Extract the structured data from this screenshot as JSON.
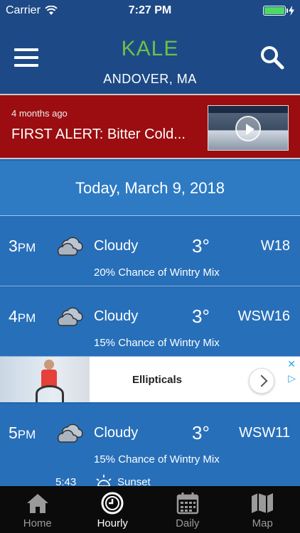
{
  "status_bar": {
    "carrier": "Carrier",
    "time": "7:27 PM",
    "battery_level": 1.0
  },
  "header": {
    "logo": "KALE",
    "location": "ANDOVER, MA"
  },
  "alert": {
    "age": "4 months ago",
    "headline": "FIRST ALERT: Bitter Cold..."
  },
  "forecast": {
    "date": "Today, March 9, 2018",
    "hours": [
      {
        "hour": "3",
        "period": "PM",
        "condition": "Cloudy",
        "temp": "3°",
        "wind": "W18",
        "precip": "20% Chance of Wintry Mix"
      },
      {
        "hour": "4",
        "period": "PM",
        "condition": "Cloudy",
        "temp": "3°",
        "wind": "WSW16",
        "precip": "15% Chance of Wintry Mix"
      },
      {
        "hour": "5",
        "period": "PM",
        "condition": "Cloudy",
        "temp": "3°",
        "wind": "WSW11",
        "precip": "15% Chance of Wintry Mix"
      }
    ],
    "sunset": {
      "time": "5:43",
      "label": "Sunset"
    }
  },
  "ad": {
    "title": "Ellipticals"
  },
  "tabs": [
    {
      "label": "Home",
      "icon": "home-icon"
    },
    {
      "label": "Hourly",
      "icon": "clock-icon"
    },
    {
      "label": "Daily",
      "icon": "calendar-icon"
    },
    {
      "label": "Map",
      "icon": "map-icon"
    }
  ],
  "colors": {
    "header": "#1d4a86",
    "alert": "#9b0d10",
    "logo": "#6cc04a",
    "background": "#276fb9"
  }
}
